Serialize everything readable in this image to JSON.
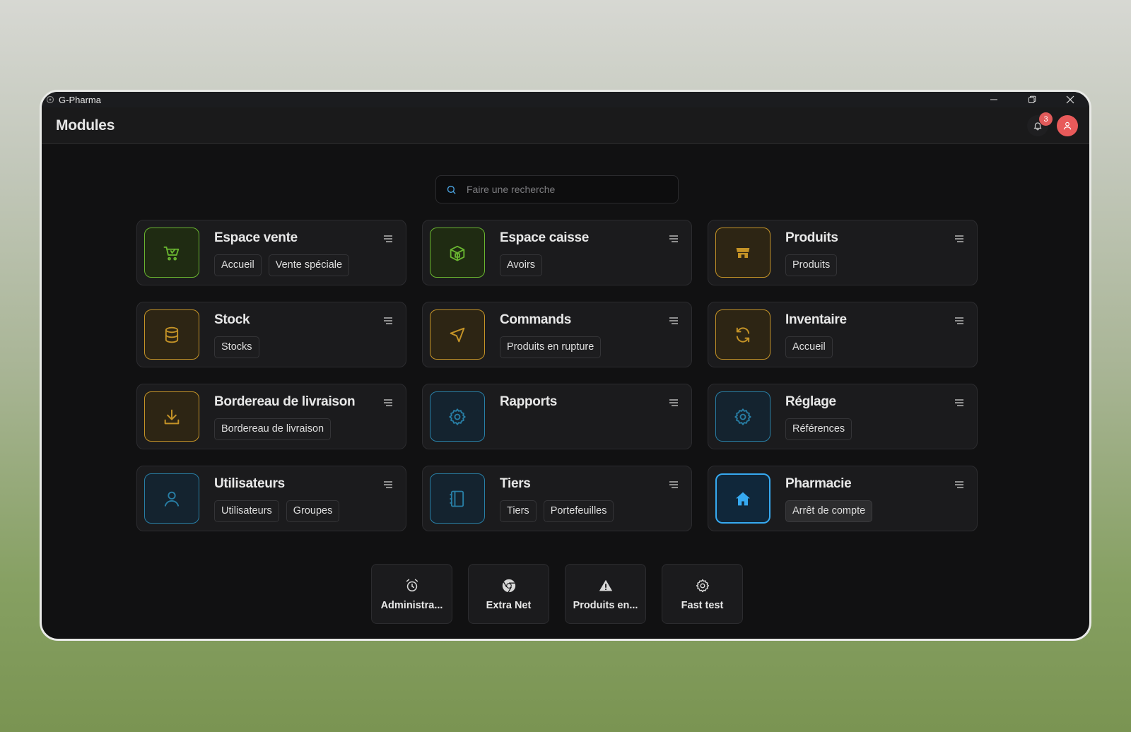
{
  "window": {
    "title": "G-Pharma"
  },
  "header": {
    "title": "Modules",
    "notifications_count": "3"
  },
  "search": {
    "placeholder": "Faire une recherche"
  },
  "modules": [
    {
      "title": "Espace vente",
      "icon": "cart-icon",
      "color": "#69b530",
      "links": [
        "Accueil",
        "Vente spéciale"
      ]
    },
    {
      "title": "Espace caisse",
      "icon": "box-icon",
      "color": "#69b530",
      "links": [
        "Avoirs"
      ]
    },
    {
      "title": "Produits",
      "icon": "store-icon",
      "color": "#c49327",
      "links": [
        "Produits"
      ]
    },
    {
      "title": "Stock",
      "icon": "database-icon",
      "color": "#c49327",
      "links": [
        "Stocks"
      ]
    },
    {
      "title": "Commands",
      "icon": "send-icon",
      "color": "#c49327",
      "links": [
        "Produits en rupture"
      ]
    },
    {
      "title": "Inventaire",
      "icon": "refresh-icon",
      "color": "#c49327",
      "links": [
        "Accueil"
      ]
    },
    {
      "title": "Bordereau de livraison",
      "icon": "download-icon",
      "color": "#c49327",
      "links": [
        "Bordereau de livraison"
      ]
    },
    {
      "title": "Rapports",
      "icon": "gear-icon",
      "color": "#287fa6",
      "links": []
    },
    {
      "title": "Réglage",
      "icon": "gear-icon",
      "color": "#287fa6",
      "links": [
        "Références"
      ]
    },
    {
      "title": "Utilisateurs",
      "icon": "user-icon",
      "color": "#287fa6",
      "links": [
        "Utilisateurs",
        "Groupes"
      ]
    },
    {
      "title": "Tiers",
      "icon": "notebook-icon",
      "color": "#287fa6",
      "links": [
        "Tiers",
        "Portefeuilles"
      ]
    },
    {
      "title": "Pharmacie",
      "icon": "home-icon",
      "color": "#36a9f0",
      "links": [
        "Arrêt de compte"
      ]
    }
  ],
  "quick_actions": [
    {
      "label": "Administra...",
      "icon": "alarm-clock-icon"
    },
    {
      "label": "Extra Net",
      "icon": "chrome-icon"
    },
    {
      "label": "Produits en...",
      "icon": "warning-icon"
    },
    {
      "label": "Fast test",
      "icon": "gear-icon"
    }
  ]
}
